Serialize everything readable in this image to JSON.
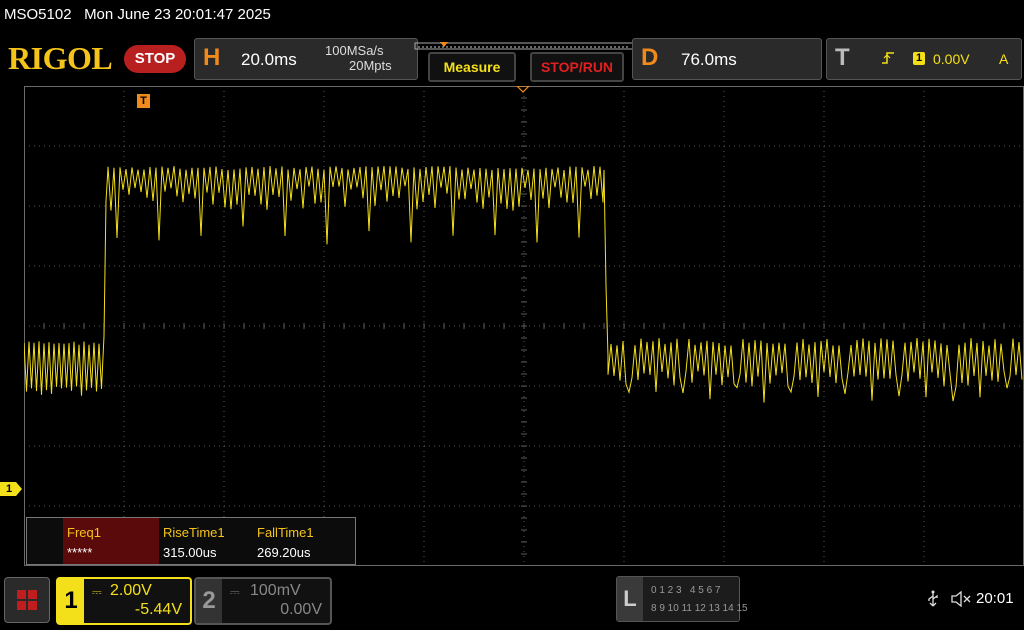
{
  "header": {
    "model": "MSO5102",
    "datetime": "Mon June 23 20:01:47 2025",
    "brand": "RIGOL",
    "run_state": "STOP"
  },
  "horizontal": {
    "letter": "H",
    "timebase": "20.0ms",
    "sample_rate": "100MSa/s",
    "memory_depth": "20Mpts"
  },
  "buttons": {
    "measure": "Measure",
    "stop_run": "STOP/RUN"
  },
  "delay": {
    "letter": "D",
    "value": "76.0ms"
  },
  "trigger": {
    "letter": "T",
    "source": "1",
    "level": "0.00V",
    "mode": "A",
    "marker_label": "T"
  },
  "channel_marker": {
    "label": "1"
  },
  "measurements": [
    {
      "name": "Freq1",
      "value": "*****"
    },
    {
      "name": "RiseTime1",
      "value": "315.00us"
    },
    {
      "name": "FallTime1",
      "value": "269.20us"
    }
  ],
  "channels": [
    {
      "number": "1",
      "scale": "2.00V",
      "offset": "-5.44V",
      "color": "#f4e01a"
    },
    {
      "number": "2",
      "scale": "100mV",
      "offset": "0.00V",
      "color": "#888888"
    }
  ],
  "logic": {
    "letter": "L",
    "row1": "0 1 2 3   4 5 6 7",
    "row2": "8 9 10 11 12 13 14 15"
  },
  "status": {
    "time": "20:01"
  },
  "colors": {
    "trace": "#f4e01a",
    "accent_orange": "#f08a1c",
    "stop_red": "#b82020"
  }
}
